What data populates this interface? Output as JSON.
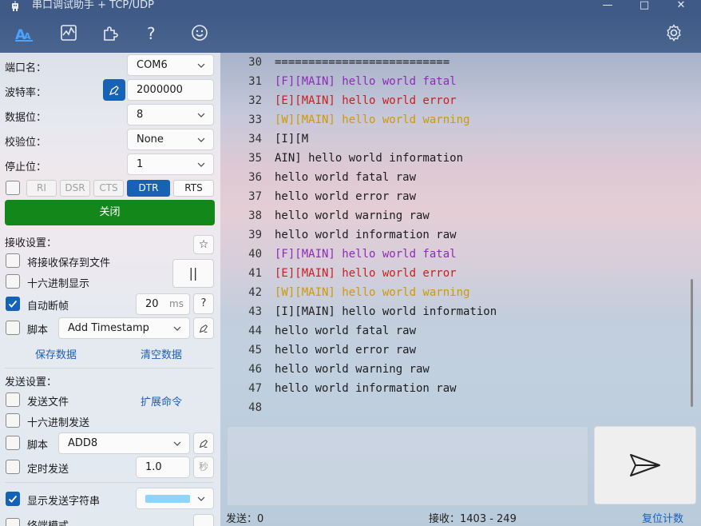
{
  "window": {
    "title": "串口调试助手 + TCP/UDP",
    "minimize": "—",
    "maximize": "□",
    "close": "✕"
  },
  "toolbar": {
    "icons": [
      "font-icon",
      "chart-icon",
      "plugin-icon",
      "help-icon",
      "smiley-icon",
      "settings-gear-icon"
    ]
  },
  "serial": {
    "port_label": "端口名：",
    "port_value": "COM6",
    "baud_label": "波特率：",
    "baud_value": "2000000",
    "databits_label": "数据位：",
    "databits_value": "8",
    "parity_label": "校验位：",
    "parity_value": "None",
    "stopbits_label": "停止位：",
    "stopbits_value": "1",
    "pins": [
      "RI",
      "DSR",
      "CTS",
      "DTR",
      "RTS"
    ],
    "close_button": "关闭"
  },
  "receive": {
    "section_label": "接收设置：",
    "save_to_file": "将接收保存到文件",
    "hex_display": "十六进制显示",
    "auto_frame": "自动断帧",
    "auto_frame_value": "20",
    "auto_frame_unit": "ms",
    "auto_frame_help": "?",
    "script_label": "脚本",
    "script_value": "Add Timestamp",
    "pause_glyph": "||",
    "star_glyph": "☆",
    "save_data": "保存数据",
    "clear_data": "清空数据"
  },
  "send": {
    "section_label": "发送设置：",
    "send_file": "发送文件",
    "ext_command": "扩展命令",
    "hex_send": "十六进制发送",
    "script_label": "脚本",
    "script_value": "ADD8",
    "timed_send": "定时发送",
    "timed_value": "1.0",
    "timed_unit": "秒",
    "show_send_string": "显示发送字符串",
    "swatch_color": "#8fd3ff",
    "partial_label": "终端模式"
  },
  "terminal": {
    "lines": [
      {
        "n": "30",
        "t": "==========================",
        "c": ""
      },
      {
        "n": "31",
        "t": "[F][MAIN] hello world fatal",
        "c": "c-purple"
      },
      {
        "n": "32",
        "t": "[E][MAIN] hello world error",
        "c": "c-red"
      },
      {
        "n": "33",
        "t": "[W][MAIN] hello world warning",
        "c": "c-yellow"
      },
      {
        "n": "34",
        "t": "[I][M",
        "c": ""
      },
      {
        "n": "35",
        "t": "AIN] hello world information",
        "c": ""
      },
      {
        "n": "36",
        "t": "hello world fatal raw",
        "c": ""
      },
      {
        "n": "37",
        "t": "hello world error raw",
        "c": ""
      },
      {
        "n": "38",
        "t": "hello world warning raw",
        "c": ""
      },
      {
        "n": "39",
        "t": "hello world information raw",
        "c": ""
      },
      {
        "n": "40",
        "t": "[F][MAIN] hello world fatal",
        "c": "c-purple"
      },
      {
        "n": "41",
        "t": "[E][MAIN] hello world error",
        "c": "c-red"
      },
      {
        "n": "42",
        "t": "[W][MAIN] hello world warning",
        "c": "c-yellow"
      },
      {
        "n": "43",
        "t": "[I][MAIN] hello world information",
        "c": ""
      },
      {
        "n": "44",
        "t": "hello world fatal raw",
        "c": ""
      },
      {
        "n": "45",
        "t": "hello world error raw",
        "c": ""
      },
      {
        "n": "46",
        "t": "hello world warning raw",
        "c": ""
      },
      {
        "n": "47",
        "t": "hello world information raw",
        "c": ""
      },
      {
        "n": "48",
        "t": "",
        "c": ""
      }
    ]
  },
  "statusbar": {
    "sent": "发送：0",
    "received": "接收：1403  -  249",
    "reset": "复位计数"
  }
}
